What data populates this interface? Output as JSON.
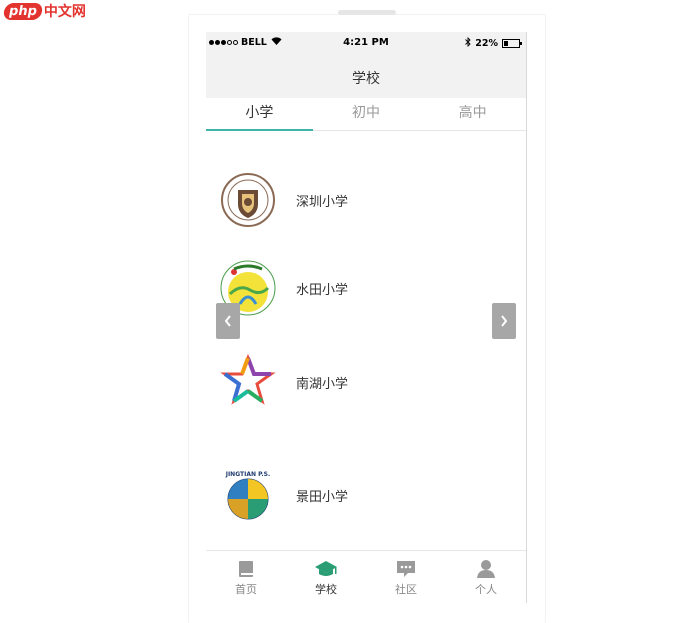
{
  "watermark": {
    "brand": "php",
    "text": "中文网"
  },
  "status_bar": {
    "carrier": "BELL",
    "time": "4:21 PM",
    "battery": "22%",
    "battery_level": 0.22
  },
  "header": {
    "title": "学校"
  },
  "tabs": [
    {
      "label": "小学",
      "active": true
    },
    {
      "label": "初中",
      "active": false
    },
    {
      "label": "高中",
      "active": false
    }
  ],
  "schools": [
    {
      "name": "深圳小学",
      "logo": "shenzhen-school-logo"
    },
    {
      "name": "水田小学",
      "logo": "shuitian-school-logo"
    },
    {
      "name": "南湖小学",
      "logo": "nanhu-school-logo"
    },
    {
      "name": "景田小学",
      "logo": "jingtian-school-logo"
    }
  ],
  "logo_text": {
    "jingtian": "JINGTIAN P.S."
  },
  "carousel": {
    "prev_icon": "chevron-left-icon",
    "next_icon": "chevron-right-icon"
  },
  "nav": [
    {
      "label": "首页",
      "icon": "book-icon",
      "active": false
    },
    {
      "label": "学校",
      "icon": "graduation-cap-icon",
      "active": true
    },
    {
      "label": "社区",
      "icon": "chat-bubble-icon",
      "active": false
    },
    {
      "label": "个人",
      "icon": "person-icon",
      "active": false
    }
  ],
  "colors": {
    "accent": "#3cb5a8",
    "active_icon": "#2a9d74",
    "inactive_icon": "#9a9a9a",
    "header_bg": "#f2f2f2"
  }
}
